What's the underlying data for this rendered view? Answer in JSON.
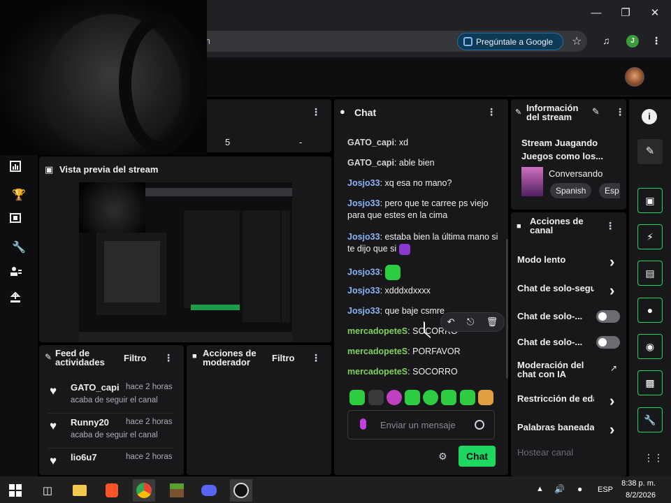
{
  "browser": {
    "url_fragment": "m",
    "google_pill": "Pregúntale a Google",
    "profile_initial": "J"
  },
  "prev_panel": {
    "value_a": "5",
    "value_b": "-"
  },
  "preview": {
    "title": "Vista previa del stream"
  },
  "chat": {
    "title": "Chat",
    "messages": [
      {
        "user": "GATO_capi",
        "text": "xd",
        "color": "#d6d6d6"
      },
      {
        "user": "GATO_capi",
        "text": "able bien",
        "color": "#d6d6d6"
      },
      {
        "user": "Josjo33",
        "text": "xq esa no mano?",
        "color": "#8ab4f8"
      },
      {
        "user": "Josjo33",
        "text": "pero que te carree ps viejo para que estes en la cima",
        "color": "#8ab4f8"
      },
      {
        "user": "Josjo33",
        "text": "estaba bien la última mano si te dijo que si",
        "color": "#8ab4f8"
      },
      {
        "user": "Josjo33",
        "text": "",
        "color": "#8ab4f8"
      },
      {
        "user": "Josjo33",
        "text": "xdddxdxxxx",
        "color": "#8ab4f8"
      },
      {
        "user": "Josjo33",
        "text": "que baje csmre",
        "color": "#8ab4f8"
      },
      {
        "user": "mercadopeteS",
        "text": "SOCORRO",
        "color": "#7fd35a"
      },
      {
        "user": "mercadopeteS",
        "text": "PORFAVOR",
        "color": "#7fd35a"
      },
      {
        "user": "mercadopeteS",
        "text": "SOCORRO",
        "color": "#7fd35a"
      }
    ],
    "input_placeholder": "Enviar un mensaje",
    "send_label": "Chat"
  },
  "stream_info": {
    "title": "Información del stream",
    "stream_title": "Stream Juagando Juegos como los...",
    "category": "Conversando",
    "tags": [
      "Spanish",
      "Esp"
    ]
  },
  "channel_actions": {
    "title": "Acciones de canal",
    "items": [
      {
        "label": "Modo lento",
        "control": "chevron"
      },
      {
        "label": "Chat de solo-segui",
        "control": "chevron"
      },
      {
        "label": "Chat de solo-...",
        "control": "toggle"
      },
      {
        "label": "Chat de solo-...",
        "control": "toggle"
      },
      {
        "label": "Moderación del chat con IA",
        "control": "external"
      },
      {
        "label": "Restricción de edad",
        "control": "chevron"
      },
      {
        "label": "Palabras baneadas",
        "control": "chevron"
      },
      {
        "label": "Hostear canal",
        "control": "none"
      }
    ]
  },
  "activity_feed": {
    "title": "Feed de actividades",
    "filter_label": "Filtro",
    "items": [
      {
        "name": "GATO_capi",
        "time": "hace 2 horas",
        "sub": "acaba de seguir el canal"
      },
      {
        "name": "Runny20",
        "time": "hace 2 horas",
        "sub": "acaba de seguir el canal"
      },
      {
        "name": "lio6u7",
        "time": "hace 2 horas",
        "sub": ""
      }
    ]
  },
  "mod_actions": {
    "title": "Acciones de moderador",
    "filter_label": "Filtro"
  },
  "taskbar": {
    "lang": "ESP",
    "time": "8:38 p. m.",
    "date": "8/2/2026"
  },
  "colors": {
    "accent": "#1ed760",
    "panel": "#18181b",
    "bg": "#0e0e10"
  }
}
